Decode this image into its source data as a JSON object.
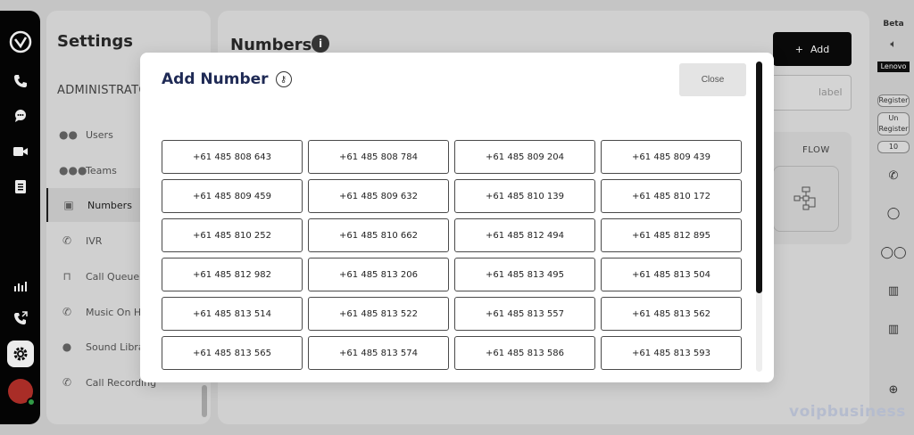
{
  "rail": {
    "icons": [
      "logo-icon",
      "phone-icon",
      "chat-icon",
      "video-icon",
      "notes-icon",
      "analytics-icon",
      "call-forward-icon",
      "settings-gear-icon",
      "avatar"
    ]
  },
  "settings": {
    "title": "Settings",
    "section": "ADMINISTRATO",
    "items": [
      {
        "label": "Users",
        "icon": "users-icon"
      },
      {
        "label": "Teams",
        "icon": "teams-icon"
      },
      {
        "label": "Numbers",
        "icon": "numbers-icon",
        "active": true
      },
      {
        "label": "IVR",
        "icon": "ivr-icon"
      },
      {
        "label": "Call Queue",
        "icon": "call-queue-icon"
      },
      {
        "label": "Music On Ho",
        "icon": "music-on-hold-icon"
      },
      {
        "label": "Sound Librar",
        "icon": "sound-library-icon"
      },
      {
        "label": "Call Recording",
        "icon": "call-recording-icon"
      }
    ]
  },
  "main": {
    "title": "Numbers",
    "add_label": "Add",
    "label_placeholder": "label",
    "flow_label": "FLOW"
  },
  "right_rail": {
    "beta": "Beta",
    "device": "Lenovo",
    "register": "Register",
    "unregister": "Un Register",
    "count": "10"
  },
  "brand": "voipbusiness",
  "modal": {
    "title": "Add Number",
    "close_label": "Close",
    "numbers": [
      "+61 485 808 643",
      "+61 485 808 784",
      "+61 485 809 204",
      "+61 485 809 439",
      "+61 485 809 459",
      "+61 485 809 632",
      "+61 485 810 139",
      "+61 485 810 172",
      "+61 485 810 252",
      "+61 485 810 662",
      "+61 485 812 494",
      "+61 485 812 895",
      "+61 485 812 982",
      "+61 485 813 206",
      "+61 485 813 495",
      "+61 485 813 504",
      "+61 485 813 514",
      "+61 485 813 522",
      "+61 485 813 557",
      "+61 485 813 562",
      "+61 485 813 565",
      "+61 485 813 574",
      "+61 485 813 586",
      "+61 485 813 593"
    ]
  },
  "colors": {
    "modal_title": "#1f2a55",
    "rail_bg": "#050505",
    "add_button_bg": "#0a0a0a"
  }
}
